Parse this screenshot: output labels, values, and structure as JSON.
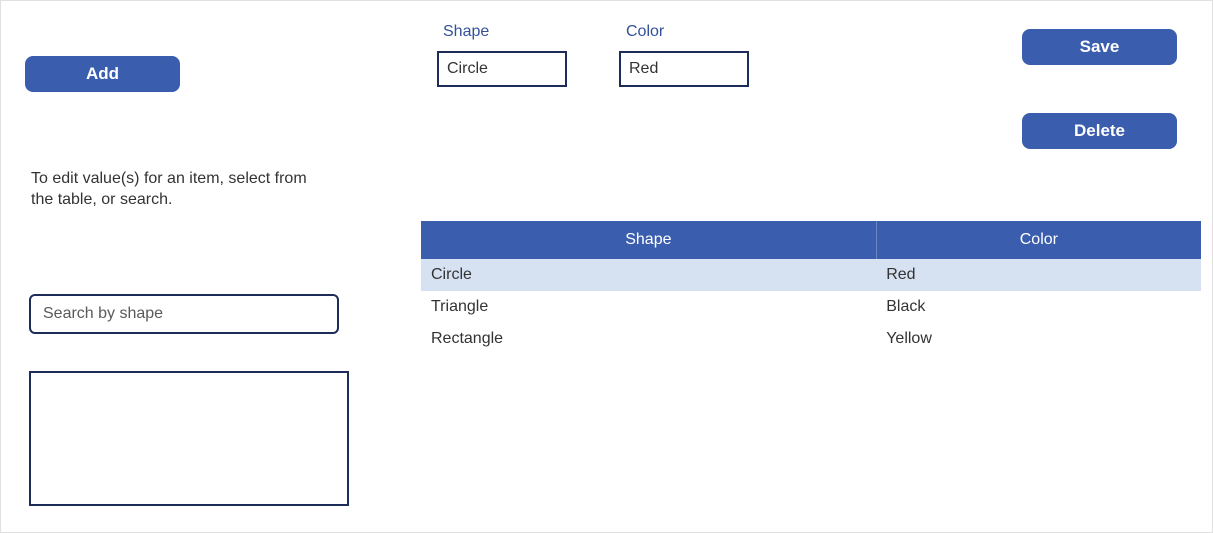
{
  "buttons": {
    "add": "Add",
    "save": "Save",
    "delete": "Delete"
  },
  "fields": {
    "shape_label": "Shape",
    "color_label": "Color",
    "shape_value": "Circle",
    "color_value": "Red"
  },
  "help_text": "To edit value(s) for an item, select from the table, or search.",
  "search": {
    "placeholder": "Search by shape",
    "value": ""
  },
  "table": {
    "headers": [
      "Shape",
      "Color"
    ],
    "rows": [
      {
        "shape": "Circle",
        "color": "Red",
        "selected": true
      },
      {
        "shape": "Triangle",
        "color": "Black",
        "selected": false
      },
      {
        "shape": "Rectangle",
        "color": "Yellow",
        "selected": false
      }
    ]
  },
  "colors": {
    "primary": "#3a5dae",
    "border_dark": "#1e2c5a",
    "row_selected": "#d6e1f2"
  }
}
